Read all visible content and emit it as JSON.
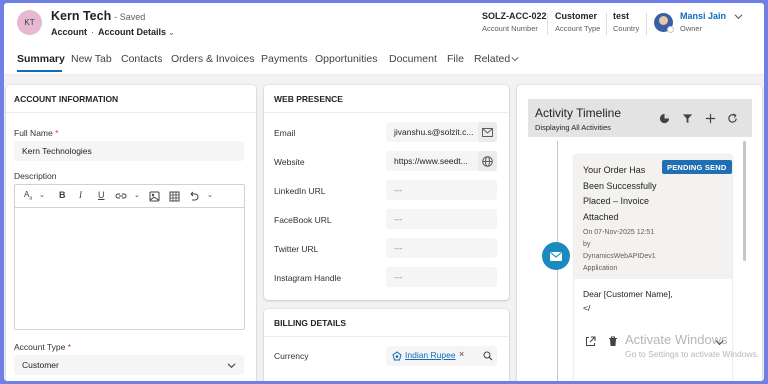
{
  "header": {
    "initials": "KT",
    "record_name": "Kern Tech",
    "save_status": "- Saved",
    "entity": "Account",
    "form_selector": "Account Details",
    "fields": [
      {
        "value": "SOLZ-ACC-022",
        "label": "Account Number"
      },
      {
        "value": "Customer",
        "label": "Account Type"
      },
      {
        "value": "test",
        "label": "Country"
      },
      {
        "value": "Mansi Jain",
        "label": "Owner"
      }
    ]
  },
  "tabs": [
    "Summary",
    "New Tab",
    "Contacts",
    "Orders & Invoices",
    "Payments",
    "Opportunities",
    "Document",
    "File",
    "Related"
  ],
  "account_info": {
    "section_title": "ACCOUNT INFORMATION",
    "full_name_label": "Full Name",
    "full_name_value": "Kern Technologies",
    "description_label": "Description",
    "account_type_label": "Account Type",
    "account_type_value": "Customer",
    "required_mark": "*"
  },
  "web_presence": {
    "section_title": "WEB PRESENCE",
    "fields": [
      {
        "label": "Email",
        "value": "jivanshu.s@solzit.c..."
      },
      {
        "label": "Website",
        "value": "https://www.seedt..."
      },
      {
        "label": "LinkedIn URL",
        "value": "---"
      },
      {
        "label": "FaceBook URL",
        "value": "---"
      },
      {
        "label": "Twitter URL",
        "value": "---"
      },
      {
        "label": "Instagram Handle",
        "value": "---"
      }
    ]
  },
  "billing": {
    "section_title": "BILLING DETAILS",
    "currency_label": "Currency",
    "currency_value": "Indian Rupee",
    "remove_mark": "×"
  },
  "timeline": {
    "title": "Activity Timeline",
    "subtitle": "Displaying All Activities",
    "item": {
      "subject": "Your Order Has Been Successfully Placed – Invoice Attached",
      "status": "PENDING SEND",
      "date": "On 07-Nov-2025 12:51",
      "by": "by",
      "author": "DynamicsWebAPIDev1",
      "author2": "Application",
      "body_line1": "Dear [Customer Name],",
      "body_line2": "</"
    }
  },
  "watermark": {
    "title": "Activate Windows",
    "subtitle": "Go to Settings to activate Windows."
  },
  "colors": {
    "accent": "#0f6cbd",
    "badge": "#1f6fb2",
    "timeline_icon": "#1b8bbf",
    "frame": "#6f7fe6"
  }
}
